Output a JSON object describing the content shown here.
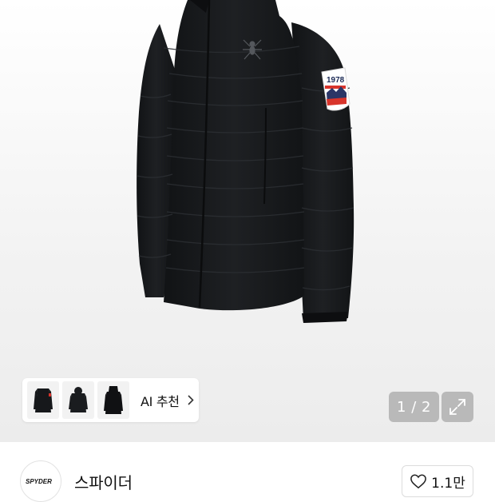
{
  "product_image": {
    "patch_year": "1978",
    "patch_brand": "SPYDER"
  },
  "ai_recommend": {
    "label": "AI 추천",
    "thumbnails": [
      "jacket-front",
      "jacket-hooded",
      "jacket-hooded-black"
    ]
  },
  "gallery": {
    "counter": "1 / 2"
  },
  "brand": {
    "logo_text": "SPYDER",
    "name": "스파이더",
    "like_count": "1.1만"
  },
  "colors": {
    "jacket": "#15171a",
    "patch_red": "#d8342b",
    "patch_navy": "#2a3566"
  }
}
